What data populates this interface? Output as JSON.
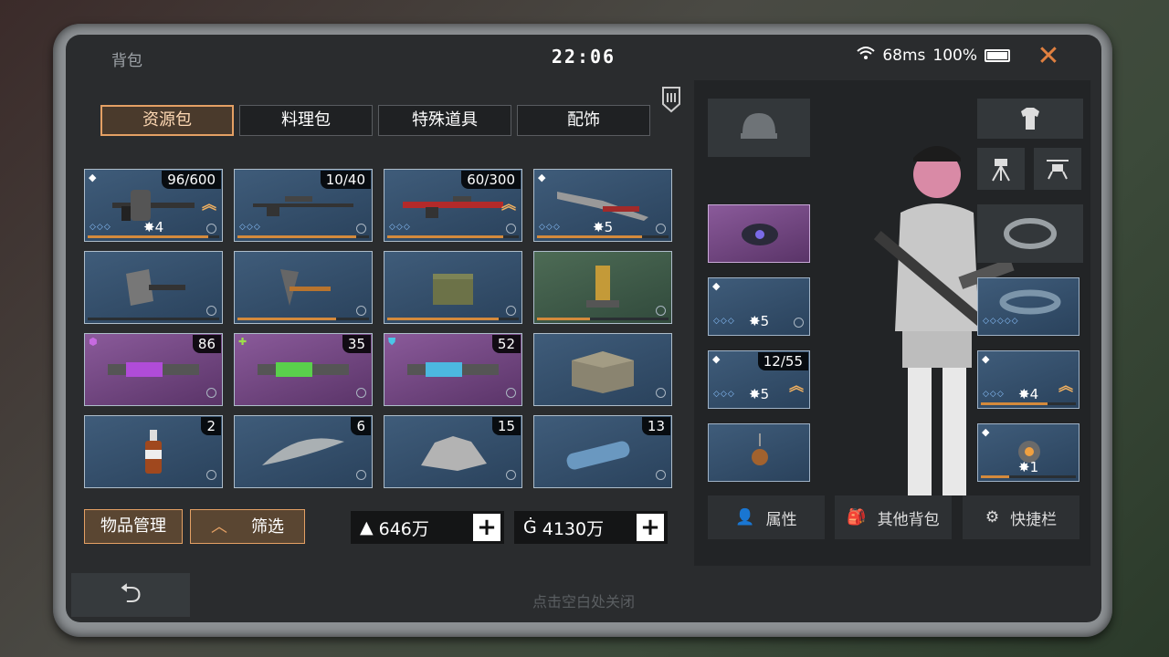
{
  "window": {
    "title": "背包",
    "time": "22:06",
    "ping": "68ms",
    "battery": "100%"
  },
  "tabs": [
    {
      "label": "资源包",
      "active": true
    },
    {
      "label": "料理包",
      "active": false
    },
    {
      "label": "特殊道具",
      "active": false
    },
    {
      "label": "配饰",
      "active": false
    }
  ],
  "inventory": [
    {
      "name": "weapon-axe-gun",
      "count": "96/600",
      "stars": "4",
      "rarity": "blue"
    },
    {
      "name": "weapon-sniper-rifle",
      "count": "10/40",
      "stars": "",
      "rarity": "blue"
    },
    {
      "name": "weapon-red-rifle",
      "count": "60/300",
      "stars": "",
      "rarity": "blue"
    },
    {
      "name": "weapon-saw-blade",
      "count": "",
      "stars": "5",
      "rarity": "blue"
    },
    {
      "name": "tool-axe",
      "count": "",
      "stars": "",
      "rarity": "blue"
    },
    {
      "name": "tool-pickaxe",
      "count": "",
      "stars": "",
      "rarity": "blue"
    },
    {
      "name": "supply-crate",
      "count": "",
      "stars": "",
      "rarity": "blue"
    },
    {
      "name": "tower-device",
      "count": "",
      "stars": "",
      "rarity": "green"
    },
    {
      "name": "injector-purple",
      "count": "86",
      "stars": "",
      "rarity": "purple"
    },
    {
      "name": "injector-green",
      "count": "35",
      "stars": "",
      "rarity": "purple"
    },
    {
      "name": "injector-blue",
      "count": "52",
      "stars": "",
      "rarity": "purple"
    },
    {
      "name": "metal-crate",
      "count": "",
      "stars": "",
      "rarity": "blue"
    },
    {
      "name": "bottle",
      "count": "2",
      "stars": "",
      "rarity": "blue"
    },
    {
      "name": "feather",
      "count": "6",
      "stars": "",
      "rarity": "blue"
    },
    {
      "name": "ore",
      "count": "15",
      "stars": "",
      "rarity": "blue"
    },
    {
      "name": "canister",
      "count": "13",
      "stars": "",
      "rarity": "blue"
    }
  ],
  "footer": {
    "manage_label": "物品管理",
    "filter_label": "筛选",
    "currency1": "646万",
    "currency2": "4130万",
    "hint": "点击空白处关闭"
  },
  "equipment": {
    "backpack_count": "12/55",
    "slot_left_2_stars": "5",
    "slot_left_3_stars": "5",
    "slot_right_2_stars": "4",
    "slot_right_3_stars": "1"
  },
  "right_buttons": {
    "attributes": "属性",
    "other_bags": "其他背包",
    "shortcut": "快捷栏"
  }
}
